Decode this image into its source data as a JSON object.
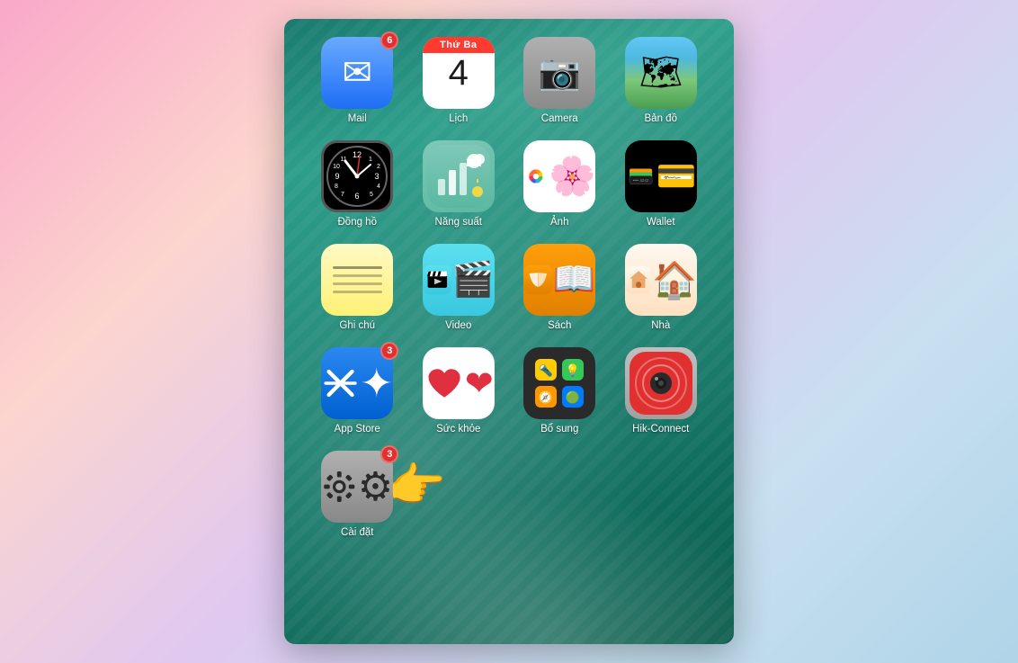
{
  "screen": {
    "title": "iOS Home Screen"
  },
  "apps": [
    {
      "id": "mail",
      "label": "Mail",
      "badge": "6",
      "icon_type": "mail"
    },
    {
      "id": "calendar",
      "label": "Lịch",
      "badge": null,
      "icon_type": "calendar",
      "calendar_day_label": "Thứ Ba",
      "calendar_day_number": "4"
    },
    {
      "id": "camera",
      "label": "Camera",
      "badge": null,
      "icon_type": "camera"
    },
    {
      "id": "maps",
      "label": "Bản đồ",
      "badge": null,
      "icon_type": "maps"
    },
    {
      "id": "clock",
      "label": "Đồng hồ",
      "badge": null,
      "icon_type": "clock"
    },
    {
      "id": "productivity",
      "label": "Năng suất",
      "badge": null,
      "icon_type": "productivity"
    },
    {
      "id": "photos",
      "label": "Ảnh",
      "badge": null,
      "icon_type": "photos"
    },
    {
      "id": "wallet",
      "label": "Wallet",
      "badge": null,
      "icon_type": "wallet"
    },
    {
      "id": "notes",
      "label": "Ghi chú",
      "badge": null,
      "icon_type": "notes"
    },
    {
      "id": "video",
      "label": "Video",
      "badge": null,
      "icon_type": "video"
    },
    {
      "id": "books",
      "label": "Sách",
      "badge": null,
      "icon_type": "books"
    },
    {
      "id": "home",
      "label": "Nhà",
      "badge": null,
      "icon_type": "home"
    },
    {
      "id": "appstore",
      "label": "App Store",
      "badge": "3",
      "icon_type": "appstore"
    },
    {
      "id": "health",
      "label": "Sức khỏe",
      "badge": null,
      "icon_type": "health"
    },
    {
      "id": "utilities",
      "label": "Bổ sung",
      "badge": null,
      "icon_type": "utilities"
    },
    {
      "id": "hikconnect",
      "label": "Hik-Connect",
      "badge": null,
      "icon_type": "hikconnect"
    },
    {
      "id": "settings",
      "label": "Cài đặt",
      "badge": "3",
      "icon_type": "settings",
      "has_hand": true
    }
  ]
}
